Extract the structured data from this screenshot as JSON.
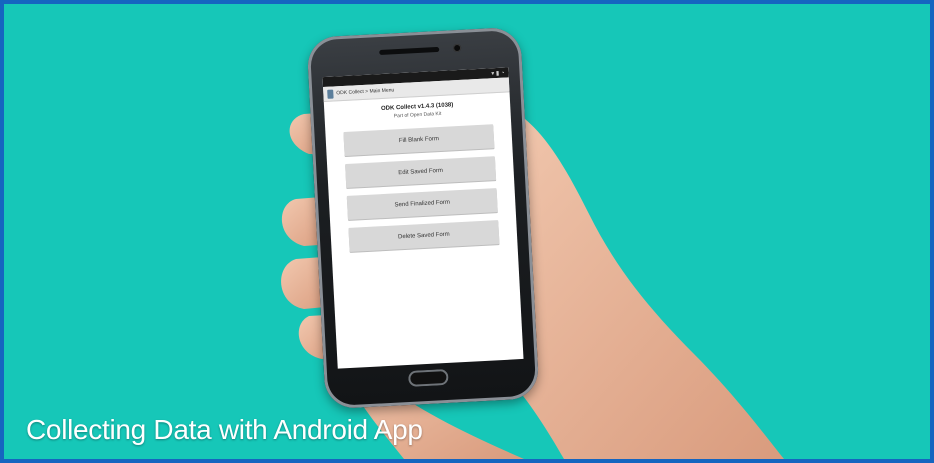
{
  "caption": "Collecting Data with Android App",
  "phone": {
    "window_title": "ODK Collect > Main Menu",
    "app_name": "ODK Collect v1.4.3 (1038)",
    "app_subtitle": "Part of Open Data Kit",
    "buttons": [
      "Fill Blank Form",
      "Edit Saved Form",
      "Send Finalized Form",
      "Delete Saved Form"
    ]
  },
  "colors": {
    "background": "#16c7b8",
    "border": "#1565c0"
  }
}
